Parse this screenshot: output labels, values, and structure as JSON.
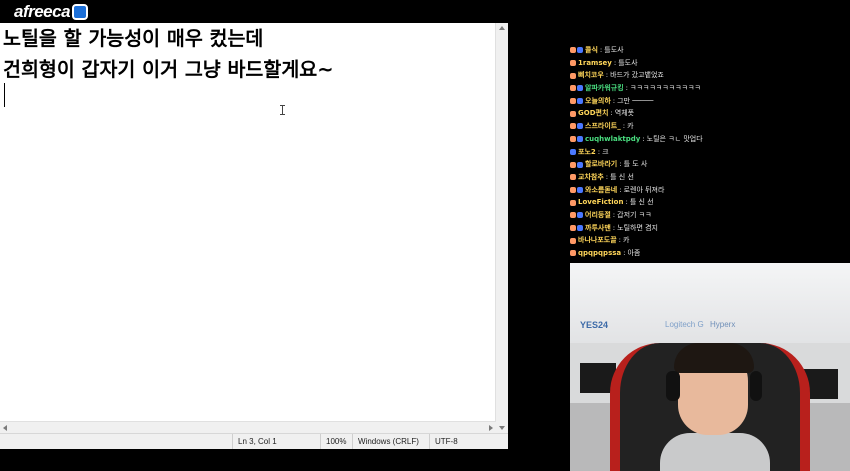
{
  "logo": {
    "text": "afreeca",
    "tv_mark": "afreecatv-tv-logo-icon"
  },
  "notepad": {
    "lines": [
      "노틸을 할 가능성이 매우 컸는데",
      "건희형이 갑자기 이거 그냥 바드할게요~"
    ],
    "status": {
      "position": "Ln 3, Col 1",
      "zoom": "100%",
      "line_ending": "Windows (CRLF)",
      "encoding": "UTF-8"
    }
  },
  "chat": {
    "messages": [
      {
        "nick": "콜식",
        "text": "틀도사",
        "color": "#ffd65a",
        "badges": [
          "a",
          "b"
        ]
      },
      {
        "nick": "1ramsey",
        "text": "틀도사",
        "color": "#ffd65a",
        "badges": [
          "a"
        ]
      },
      {
        "nick": "삐치코우",
        "text": "바드가 갔고뱉었죠",
        "color": "#ffd65a",
        "badges": [
          "a"
        ]
      },
      {
        "nick": "알파카워규킹",
        "text": "ㅋㅋㅋㅋㅋㅋㅋㅋㅋㅋㅋ",
        "color": "#4ade80",
        "badges": [
          "a",
          "b"
        ]
      },
      {
        "nick": "오늘의하",
        "text": "그만 ─────",
        "color": "#ffd65a",
        "badges": [
          "a",
          "b"
        ]
      },
      {
        "nick": "GOD편치",
        "text": "역체폿",
        "color": "#ffd65a",
        "badges": [
          "a"
        ]
      },
      {
        "nick": "스프라이트_",
        "text": "카",
        "color": "#ffd65a",
        "badges": [
          "a",
          "b"
        ]
      },
      {
        "nick": "cuqhwlaktpdy",
        "text": "노틸은 ㅋㄴ 맛업다",
        "color": "#4ade80",
        "badges": [
          "a",
          "b"
        ]
      },
      {
        "nick": "포노2",
        "text": "크",
        "color": "#ffd65a",
        "badges": [
          "b"
        ]
      },
      {
        "nick": "할로바라기",
        "text": "틀 도 사",
        "color": "#ffd65a",
        "badges": [
          "a",
          "b"
        ]
      },
      {
        "nick": "교차참추",
        "text": "틀 신 선",
        "color": "#ffd65a",
        "badges": [
          "a"
        ]
      },
      {
        "nick": "와소름돋네",
        "text": "로렌아 뒤져라",
        "color": "#ffd65a",
        "badges": [
          "a",
          "b"
        ]
      },
      {
        "nick": "LoveFiction",
        "text": "틀 신 선",
        "color": "#ffd65a",
        "badges": [
          "a"
        ]
      },
      {
        "nick": "어리둥절",
        "text": "갑저기 ㅋㅋ",
        "color": "#ffd65a",
        "badges": [
          "a",
          "b"
        ]
      },
      {
        "nick": "까투사맨",
        "text": "노틸하면 겸지",
        "color": "#ffd65a",
        "badges": [
          "a",
          "b"
        ]
      },
      {
        "nick": "바나나포도끌",
        "text": "카",
        "color": "#ffd65a",
        "badges": [
          "a"
        ]
      },
      {
        "nick": "qpqpqpssa",
        "text": "아좀",
        "color": "#ffd65a",
        "badges": [
          "a"
        ]
      }
    ]
  },
  "webcam": {
    "sponsors": [
      "YES24",
      "Logitech G",
      "Hyperx"
    ]
  }
}
